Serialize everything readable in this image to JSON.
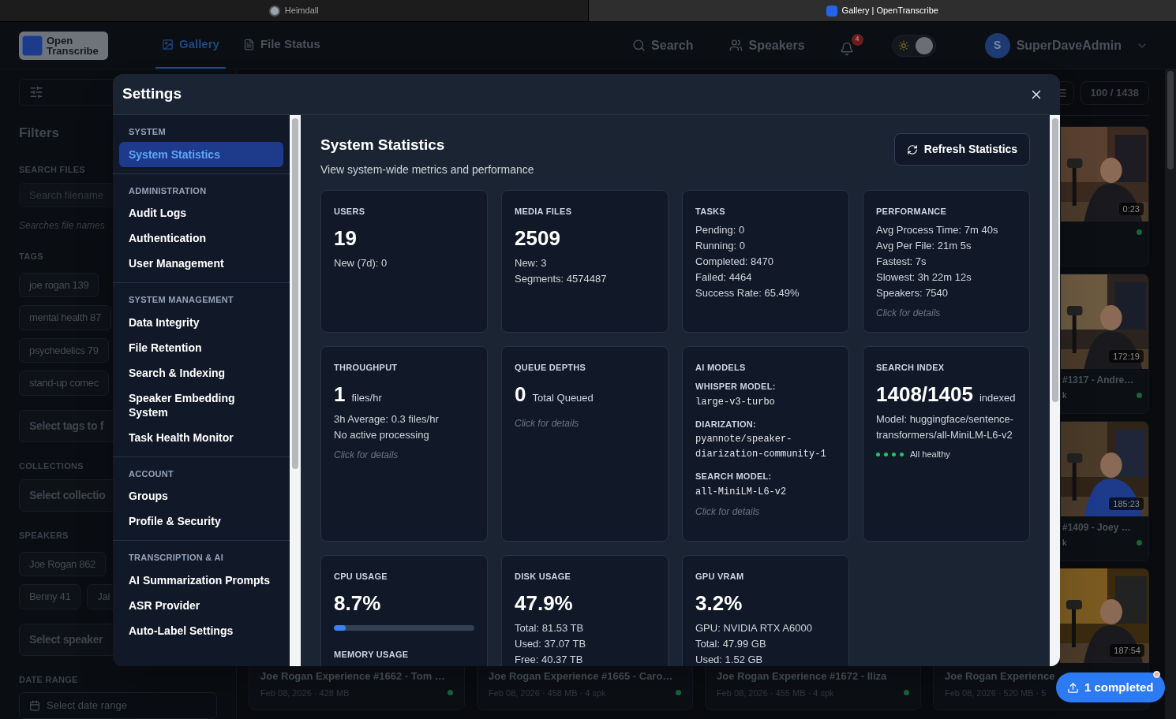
{
  "browser_tabs": [
    {
      "title": "Heimdall",
      "selected": false
    },
    {
      "title": "Gallery | OpenTranscribe",
      "selected": true
    }
  ],
  "header": {
    "logo": [
      "Open",
      "Transcribe"
    ],
    "nav": [
      {
        "label": "Gallery",
        "selected": true
      },
      {
        "label": "File Status",
        "selected": false
      }
    ],
    "actions": [
      {
        "label": "Search"
      },
      {
        "label": "Speakers"
      }
    ],
    "notifications": {
      "count": "4"
    },
    "theme_toggle": {
      "on": true
    },
    "user": {
      "initial": "S",
      "name": "SuperDaveAdmin"
    }
  },
  "filters": {
    "title": "Filters",
    "search": {
      "label": "SEARCH FILES",
      "placeholder": "Search filename",
      "hint": "Searches file names"
    },
    "tags": {
      "label": "TAGS",
      "rows": [
        [
          "joe rogan 139"
        ],
        [
          "mental health 87"
        ],
        [
          "psychedelics 79"
        ],
        [
          "stand-up comec"
        ]
      ],
      "select_placeholder": "Select tags to f"
    },
    "collections": {
      "label": "COLLECTIONS",
      "select_placeholder": "Select collectio"
    },
    "speakers": {
      "label": "SPEAKERS",
      "rows": [
        [
          "Joe Rogan 862"
        ],
        [
          "Benny 41",
          "Jai"
        ]
      ],
      "select_placeholder": "Select speaker"
    },
    "date_range": {
      "label": "DATE RANGE",
      "placeholder": "Select date range"
    }
  },
  "gallery": {
    "count": "100 / 1438",
    "side_cards": [
      {
        "duration": "0:23",
        "ready": true
      },
      {
        "duration": "172:19",
        "title": "#1317 - Andre…",
        "meta": "k",
        "ready": true
      },
      {
        "duration": "185:23",
        "title": "#1409 - Joey …",
        "meta": "k",
        "ready": true
      }
    ],
    "last_thumb": {
      "duration": "187:54"
    },
    "bottom_cards": [
      {
        "title": "Joe Rogan Experience #1662 - Tom …",
        "meta": "Feb 08, 2026 · 428 MB",
        "ready": true
      },
      {
        "title": "Joe Rogan Experience #1665 - Caro…",
        "meta": "Feb 08, 2026 · 458 MB · 4 spk",
        "ready": true
      },
      {
        "title": "Joe Rogan Experience #1672 - Iliza",
        "meta": "Feb 08, 2026 · 455 MB · 4 spk",
        "ready": true
      },
      {
        "title": "Joe Rogan Experience",
        "meta": "Feb 08, 2026 · 520 MB · 5"
      }
    ]
  },
  "upload_status": {
    "label": "1 completed"
  },
  "settings": {
    "title": "Settings",
    "nav": [
      {
        "heading": "SYSTEM",
        "items": [
          {
            "label": "System Statistics",
            "selected": true
          }
        ]
      },
      {
        "heading": "ADMINISTRATION",
        "items": [
          {
            "label": "Audit Logs",
            "selected": false
          },
          {
            "label": "Authentication",
            "selected": false
          },
          {
            "label": "User Management",
            "selected": false
          }
        ]
      },
      {
        "heading": "SYSTEM MANAGEMENT",
        "items": [
          {
            "label": "Data Integrity",
            "selected": false
          },
          {
            "label": "File Retention",
            "selected": false
          },
          {
            "label": "Search & Indexing",
            "selected": false
          },
          {
            "label": "Speaker Embedding System",
            "selected": false
          },
          {
            "label": "Task Health Monitor",
            "selected": false
          }
        ]
      },
      {
        "heading": "ACCOUNT",
        "items": [
          {
            "label": "Groups",
            "selected": false
          },
          {
            "label": "Profile & Security",
            "selected": false
          }
        ]
      },
      {
        "heading": "TRANSCRIPTION & AI",
        "items": [
          {
            "label": "AI Summarization Prompts",
            "selected": false
          },
          {
            "label": "ASR Provider",
            "selected": false
          },
          {
            "label": "Auto-Label Settings",
            "selected": false
          }
        ]
      }
    ],
    "page": {
      "title": "System Statistics",
      "subtitle": "View system-wide metrics and performance",
      "refresh": "Refresh Statistics",
      "cards": [
        {
          "kind": "stat",
          "label": "USERS",
          "value": "19",
          "lines": [
            "New (7d): 0"
          ]
        },
        {
          "kind": "stat",
          "label": "MEDIA FILES",
          "value": "2509",
          "lines": [
            "New: 3",
            "Segments: 4574487"
          ]
        },
        {
          "kind": "list",
          "label": "TASKS",
          "lines": [
            "Pending: 0",
            "Running: 0",
            "Completed: 8470",
            "Failed: 4464",
            "Success Rate: 65.49%"
          ]
        },
        {
          "kind": "list",
          "label": "PERFORMANCE",
          "lines": [
            "Avg Process Time: 7m 40s",
            "Avg Per File: 21m 5s",
            "Fastest: 7s",
            "Slowest: 3h 22m 12s",
            "Speakers: 7540"
          ],
          "note": "Click for details"
        },
        {
          "kind": "stat",
          "label": "THROUGHPUT",
          "value": "1",
          "unit": "files/hr",
          "lines": [
            "3h Average: 0.3 files/hr",
            "No active processing"
          ],
          "note": "Click for details"
        },
        {
          "kind": "stat",
          "label": "QUEUE DEPTHS",
          "value": "0",
          "unit": "Total Queued",
          "note": "Click for details"
        },
        {
          "kind": "models",
          "label": "AI MODELS",
          "models": [
            {
              "label": "WHISPER MODEL:",
              "value": "large-v3-turbo"
            },
            {
              "label": "DIARIZATION:",
              "value": "pyannote/speaker-diarization-community-1"
            },
            {
              "label": "SEARCH MODEL:",
              "value": "all-MiniLM-L6-v2"
            }
          ],
          "note": "Click for details"
        },
        {
          "kind": "stat",
          "label": "SEARCH INDEX",
          "value": "1408/1405",
          "unit": "indexed",
          "lines": [
            "Model: huggingface/sentence-transformers/all-MiniLM-L6-v2"
          ],
          "health": {
            "dots": [
              {
                "ok": true
              },
              {
                "ok": true
              },
              {
                "ok": true
              },
              {
                "ok": true
              }
            ],
            "label": "All healthy"
          }
        },
        {
          "kind": "usage",
          "label": "CPU USAGE",
          "value": "8.7%",
          "level": 0.087,
          "sub_label": "MEMORY USAGE"
        },
        {
          "kind": "stat",
          "label": "DISK USAGE",
          "value": "47.9%",
          "lines": [
            "Total: 81.53 TB",
            "Used: 37.07 TB",
            "Free: 40.37 TB"
          ]
        },
        {
          "kind": "stat",
          "label": "GPU VRAM",
          "value": "3.2%",
          "lines": [
            "GPU: NVIDIA RTX A6000",
            "Total: 47.99 GB",
            "Used: 1.52 GB"
          ]
        }
      ]
    }
  }
}
